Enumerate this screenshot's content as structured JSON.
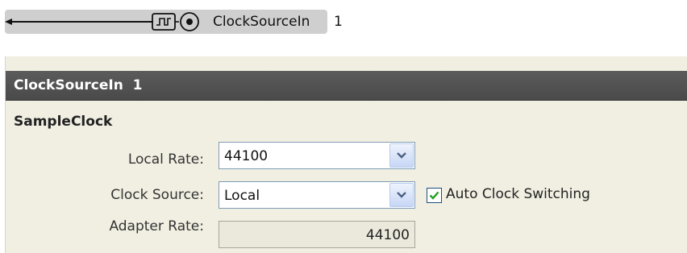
{
  "block": {
    "name": "ClockSourceIn",
    "index": "1"
  },
  "panel": {
    "title": "ClockSourceIn  1",
    "section": "SampleClock",
    "local_rate": {
      "label": "Local Rate:",
      "value": "44100"
    },
    "clock_source": {
      "label": "Clock Source:",
      "value": "Local"
    },
    "auto_switch": {
      "label": "Auto Clock Switching",
      "checked": true
    },
    "adapter_rate": {
      "label": "Adapter Rate:",
      "value": "44100"
    }
  },
  "colors": {
    "header": "#4f4f4f",
    "panel_bg": "#f1efe2",
    "check_green": "#21a121"
  }
}
